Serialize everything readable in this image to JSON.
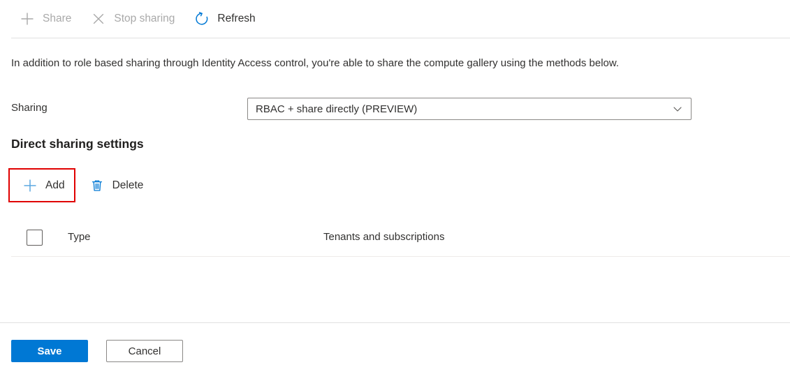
{
  "toolbar": {
    "items": [
      {
        "label": "Share",
        "icon": "plus-icon",
        "enabled": false
      },
      {
        "label": "Stop sharing",
        "icon": "close-x-icon",
        "enabled": false
      },
      {
        "label": "Refresh",
        "icon": "refresh-icon",
        "enabled": true
      }
    ]
  },
  "description": "In addition to role based sharing through Identity Access control, you're able to share the compute gallery using the methods below.",
  "sharing_field": {
    "label": "Sharing",
    "selected_value": "RBAC + share directly (PREVIEW)",
    "caret_icon": "chevron-down-icon"
  },
  "section": {
    "heading": "Direct sharing settings",
    "commands": [
      {
        "label": "Add",
        "icon": "plus-icon",
        "highlighted": true
      },
      {
        "label": "Delete",
        "icon": "trash-icon",
        "highlighted": false
      }
    ]
  },
  "table": {
    "columns": [
      {
        "label": "Type"
      },
      {
        "label": "Tenants and subscriptions"
      }
    ],
    "rows": []
  },
  "footer": {
    "save_label": "Save",
    "cancel_label": "Cancel"
  },
  "colors": {
    "accent_blue": "#0078d4",
    "disabled_gray": "#a9a9a9",
    "text": "#323130",
    "annotation_red": "#e00000",
    "divider": "#e1e1e1"
  }
}
